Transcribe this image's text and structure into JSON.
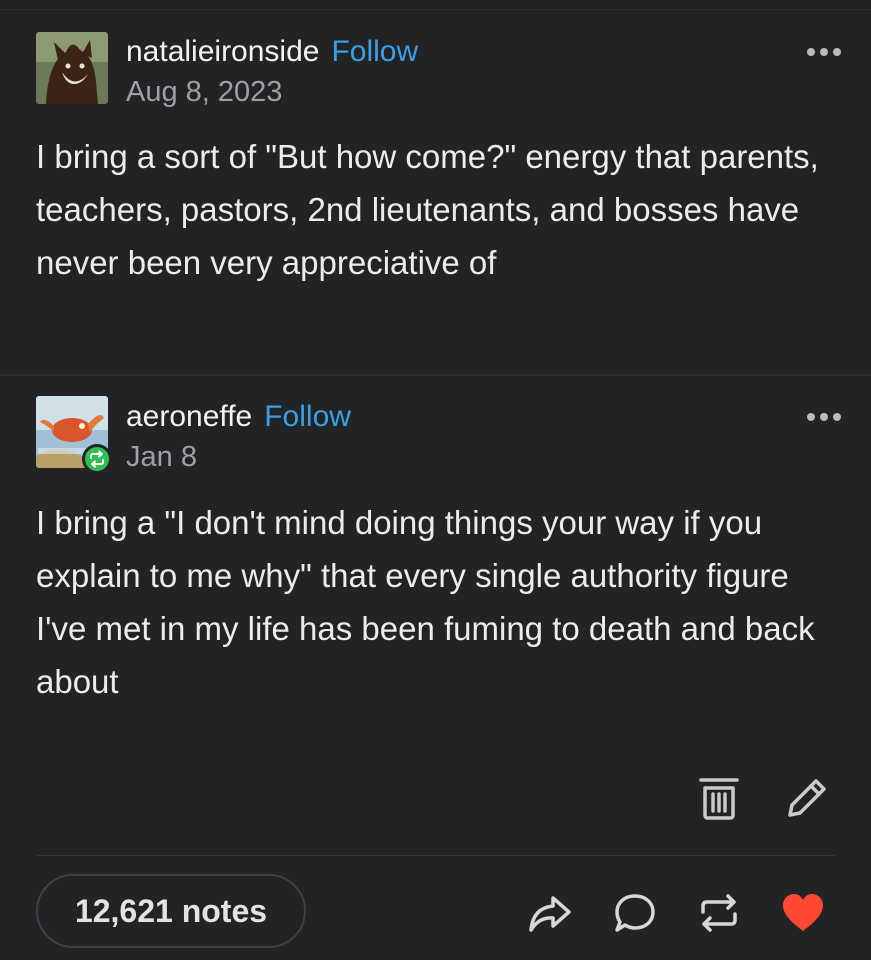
{
  "posts": [
    {
      "username": "natalieironside",
      "follow_label": "Follow",
      "date": "Aug 8, 2023",
      "body": "I bring a sort of \"But how come?\" energy that parents, teachers, pastors, 2nd lieutenants, and bosses have never been very appreciative of"
    },
    {
      "username": "aeroneffe",
      "follow_label": "Follow",
      "date": "Jan 8",
      "body": "I bring a \"I don't mind doing things your way if you explain to me why\" that every single authority figure I've met in my life has been fuming to death and back about"
    }
  ],
  "footer": {
    "notes_label": "12,621 notes"
  },
  "colors": {
    "background": "#222325",
    "follow_blue": "#3b9fe6",
    "reblog_green": "#2fbf52",
    "like_red": "#ff4930"
  },
  "icons": [
    "more-options-icon",
    "reblog-badge-icon",
    "trash-icon",
    "pencil-icon",
    "share-icon",
    "comment-icon",
    "reblog-icon",
    "heart-icon"
  ]
}
